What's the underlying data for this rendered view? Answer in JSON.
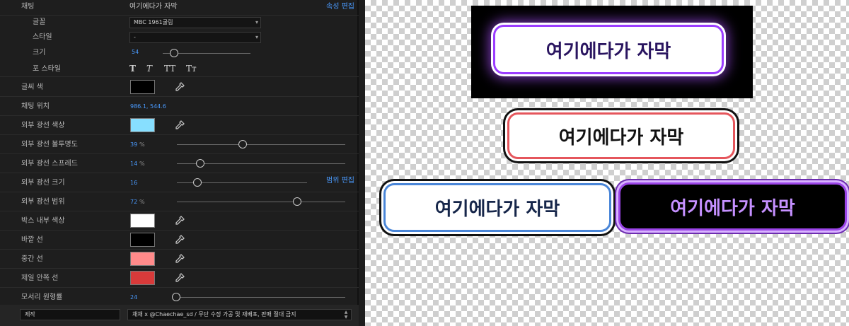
{
  "panel": {
    "header": {
      "title": "채팅",
      "subtitle": "여기에다가 자막",
      "link": "속성 편집"
    },
    "font": {
      "label": "글꼴",
      "value": "MBC 1961굴림"
    },
    "style": {
      "label": "스타일",
      "value": "-"
    },
    "size": {
      "label": "크기",
      "value": "54"
    },
    "font_style": {
      "label": "포 스타일",
      "buttons": [
        "T",
        "T",
        "TT",
        "Tт"
      ]
    },
    "text_color": {
      "label": "글씨 색",
      "color": "#000000"
    },
    "position": {
      "label": "채팅 위치",
      "value": "986.1, 544.6"
    },
    "outer_glow_color": {
      "label": "외부 광선 색상",
      "color": "#87dfff"
    },
    "outer_glow_opacity": {
      "label": "외부 광선 불투명도",
      "value": "39",
      "unit": "%",
      "fraction": 0.39
    },
    "outer_glow_spread": {
      "label": "외부 광선 스프레드",
      "value": "14",
      "unit": "%",
      "fraction": 0.14
    },
    "outer_glow_size": {
      "label": "외부 광선 크기",
      "value": "16",
      "link": "범위 편집",
      "fraction": 0.16
    },
    "outer_glow_range": {
      "label": "외부 광선 범위",
      "value": "72",
      "unit": "%",
      "fraction": 0.72
    },
    "box_inner_color": {
      "label": "박스 내부 색상",
      "color": "#ffffff"
    },
    "outer_line": {
      "label": "바깥 선",
      "color": "#000000"
    },
    "middle_line": {
      "label": "중간 선",
      "color": "#ff8a8a"
    },
    "innermost_line": {
      "label": "제일 안쪽 선",
      "color": "#d83a3a"
    },
    "corner_roundness": {
      "label": "모서리 원형률",
      "value": "24",
      "fraction": 0.0
    },
    "credit": {
      "label": "제작",
      "value": "채채 x @Chaechae_sd / 무단 수정 가공 및 재배포, 판매 절대 금지"
    }
  },
  "preview": {
    "subtitles": [
      "여기에다가 자막",
      "여기에다가 자막",
      "여기에다가 자막",
      "여기에다가 자막"
    ]
  }
}
